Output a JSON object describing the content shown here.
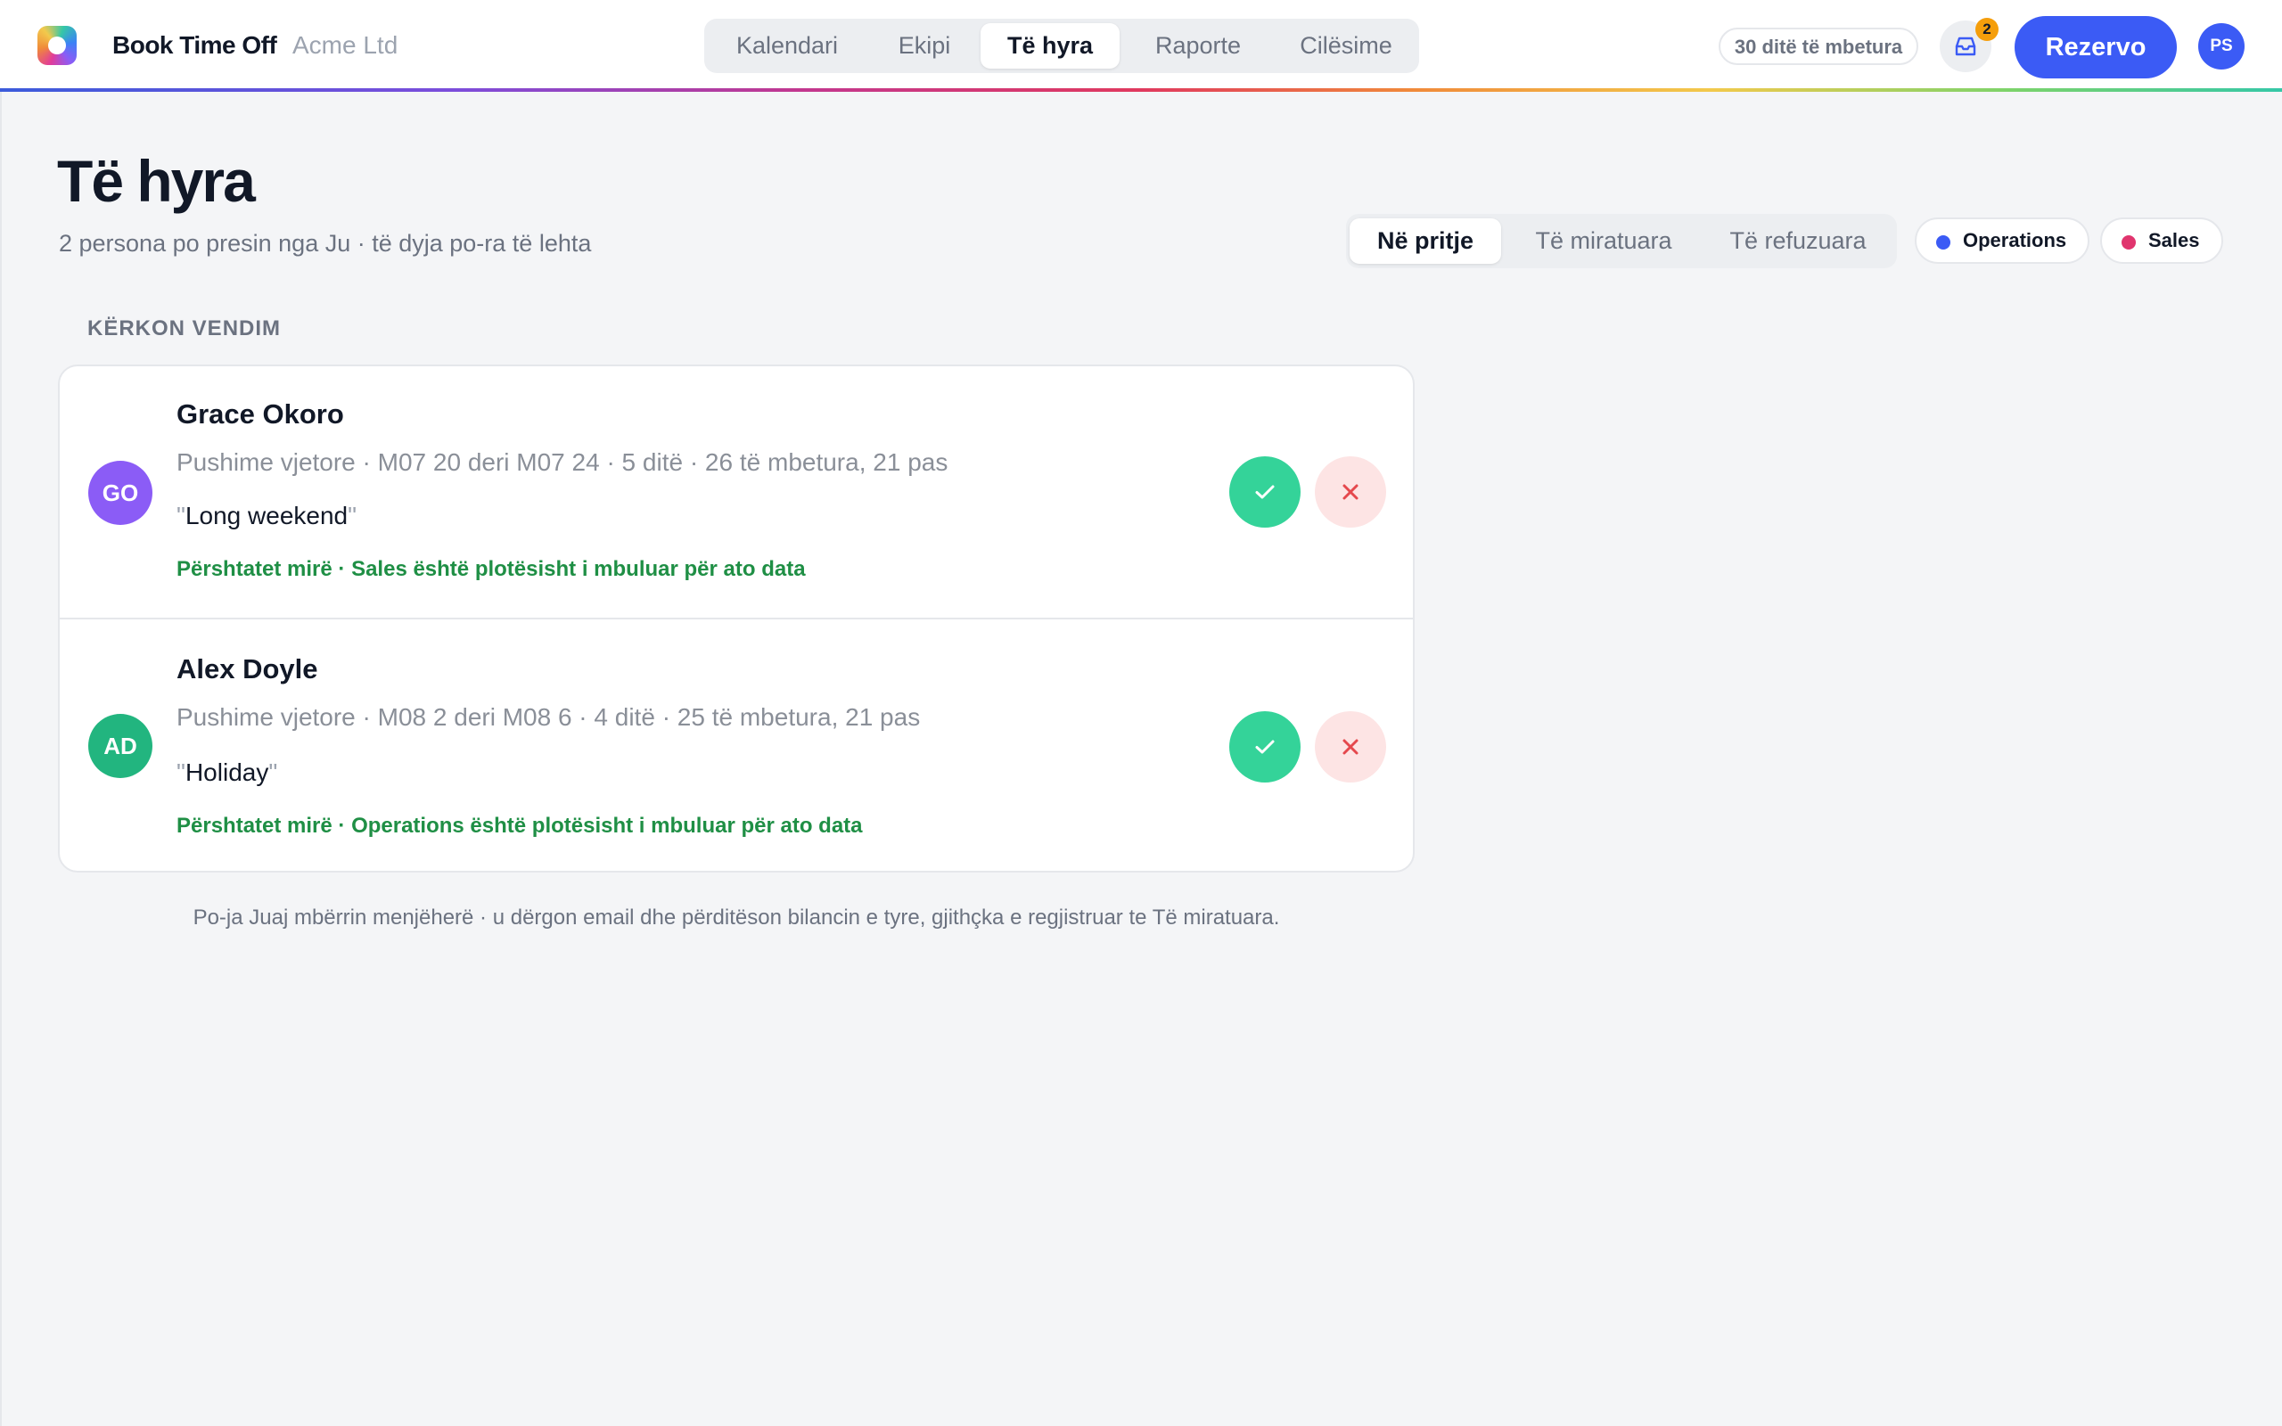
{
  "app": {
    "name": "Book Time Off",
    "org": "Acme Ltd"
  },
  "nav": {
    "tabs": [
      {
        "label": "Kalendari",
        "active": false
      },
      {
        "label": "Ekipi",
        "active": false
      },
      {
        "label": "Të hyra",
        "active": true
      },
      {
        "label": "Raporte",
        "active": false
      },
      {
        "label": "Cilësime",
        "active": false
      }
    ]
  },
  "header": {
    "days_left": "30 ditë të mbetura",
    "inbox_icon": "inbox-icon",
    "inbox_count": "2",
    "book_label": "Rezervo",
    "user_initials": "PS",
    "brand_color": "#3b5bf5"
  },
  "page": {
    "title": "Të hyra",
    "subtitle": "2 persona po presin nga Ju · të dyja po-ra të lehta"
  },
  "filter": {
    "tabs": [
      {
        "label": "Në pritje",
        "active": true
      },
      {
        "label": "Të miratuara",
        "active": false
      },
      {
        "label": "Të refuzuara",
        "active": false
      }
    ],
    "chips": [
      {
        "label": "Operations",
        "color": "#3b5bf5"
      },
      {
        "label": "Sales",
        "color": "#e0356e"
      }
    ]
  },
  "section": {
    "label": "KËRKON VENDIM"
  },
  "requests": [
    {
      "initials": "GO",
      "avatar_color": "#8b5cf6",
      "name": "Grace Okoro",
      "meta": "Pushime vjetore · M07 20 deri M07 24 · 5 ditë · 26 të mbetura, 21 pas",
      "quote": "Long weekend",
      "fit": "Përshtatet mirë · Sales është plotësisht i mbuluar për ato data",
      "approve_icon": "check-icon",
      "deny_icon": "close-icon"
    },
    {
      "initials": "AD",
      "avatar_color": "#22b57f",
      "name": "Alex Doyle",
      "meta": "Pushime vjetore · M08 2 deri M08 6 · 4 ditë · 25 të mbetura, 21 pas",
      "quote": "Holiday",
      "fit": "Përshtatet mirë · Operations është plotësisht i mbuluar për ato data",
      "approve_icon": "check-icon",
      "deny_icon": "close-icon"
    }
  ],
  "footnote": "Po-ja Juaj mbërrin menjëherë · u dërgon email dhe përditëson bilancin e tyre, gjithçka e regjistruar te Të miratuara."
}
